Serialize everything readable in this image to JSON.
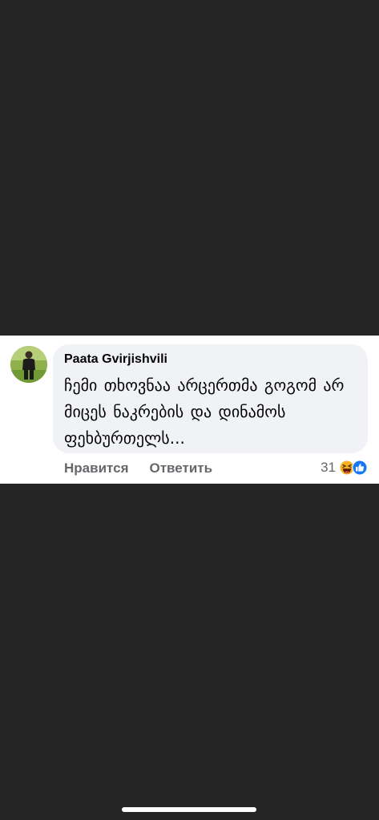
{
  "comment": {
    "author": "Paata Gvirjishvili",
    "text": "ჩემი თხოვნაა არცერთმა გოგომ არ მიცეს ნაკრების და დინამოს ფეხბურთელს...",
    "avatar_icon": "user-photo-avatar"
  },
  "actions": {
    "like_label": "Нравится",
    "reply_label": "Ответить"
  },
  "reactions": {
    "count": "31",
    "icons": [
      "haha-reaction-icon",
      "like-reaction-icon"
    ]
  },
  "colors": {
    "background": "#242424",
    "card": "#ffffff",
    "bubble": "#f0f2f5",
    "secondary_text": "#65676b",
    "like_blue": "#1877f2",
    "haha_yellow": "#f7b125"
  }
}
